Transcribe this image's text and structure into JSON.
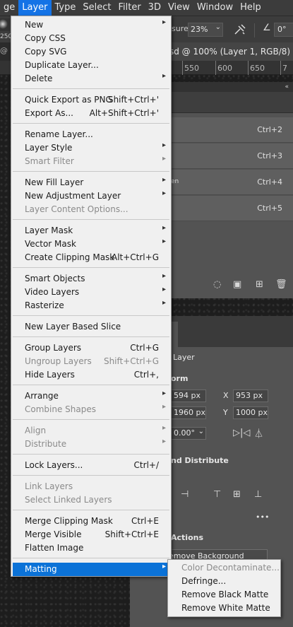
{
  "menubar": {
    "items": [
      "ge",
      "Layer",
      "Type",
      "Select",
      "Filter",
      "3D",
      "View",
      "Window",
      "Help"
    ],
    "active_index": 1
  },
  "options_bar": {
    "brush_size": "250",
    "pressure_label": "sure:",
    "pressure_value": "23%",
    "angle_value": "0°"
  },
  "document": {
    "left_tab_fragment": "@ 3",
    "tab_title": "sd @ 100% (Layer 1, RGB/8) *",
    "close_glyph": "×",
    "ruler_ticks": [
      "550",
      "600",
      "650",
      "7"
    ]
  },
  "layers_panel": {
    "rows": [
      {
        "text": "",
        "shortcut": "Ctrl+2"
      },
      {
        "text": "",
        "shortcut": "Ctrl+3"
      },
      {
        "text": "en",
        "shortcut": "Ctrl+4"
      },
      {
        "text": "",
        "shortcut": "Ctrl+5"
      }
    ]
  },
  "properties_panel": {
    "kind_label": "Layer",
    "transform_label": "orm",
    "w_value": "594 px",
    "x_label": "X",
    "x_value": "953 px",
    "h_value": "1960 px",
    "y_label": "Y",
    "y_value": "1000 px",
    "angle_value": "0.00°",
    "align_label": "nd Distribute",
    "more": "•••",
    "quick_actions_label": "Actions",
    "remove_bg_label": "emove Background"
  },
  "layer_menu": {
    "sections": [
      [
        {
          "label": "New",
          "shortcut": "",
          "submenu": true,
          "disabled": false
        },
        {
          "label": "Copy CSS",
          "shortcut": "",
          "submenu": false,
          "disabled": false
        },
        {
          "label": "Copy SVG",
          "shortcut": "",
          "submenu": false,
          "disabled": false
        },
        {
          "label": "Duplicate Layer...",
          "shortcut": "",
          "submenu": false,
          "disabled": false
        },
        {
          "label": "Delete",
          "shortcut": "",
          "submenu": true,
          "disabled": false
        }
      ],
      [
        {
          "label": "Quick Export as PNG",
          "shortcut": "Shift+Ctrl+'",
          "submenu": false,
          "disabled": false
        },
        {
          "label": "Export As...",
          "shortcut": "Alt+Shift+Ctrl+'",
          "submenu": false,
          "disabled": false
        }
      ],
      [
        {
          "label": "Rename Layer...",
          "shortcut": "",
          "submenu": false,
          "disabled": false
        },
        {
          "label": "Layer Style",
          "shortcut": "",
          "submenu": true,
          "disabled": false
        },
        {
          "label": "Smart Filter",
          "shortcut": "",
          "submenu": true,
          "disabled": true
        }
      ],
      [
        {
          "label": "New Fill Layer",
          "shortcut": "",
          "submenu": true,
          "disabled": false
        },
        {
          "label": "New Adjustment Layer",
          "shortcut": "",
          "submenu": true,
          "disabled": false
        },
        {
          "label": "Layer Content Options...",
          "shortcut": "",
          "submenu": false,
          "disabled": true
        }
      ],
      [
        {
          "label": "Layer Mask",
          "shortcut": "",
          "submenu": true,
          "disabled": false
        },
        {
          "label": "Vector Mask",
          "shortcut": "",
          "submenu": true,
          "disabled": false
        },
        {
          "label": "Create Clipping Mask",
          "shortcut": "Alt+Ctrl+G",
          "submenu": false,
          "disabled": false
        }
      ],
      [
        {
          "label": "Smart Objects",
          "shortcut": "",
          "submenu": true,
          "disabled": false
        },
        {
          "label": "Video Layers",
          "shortcut": "",
          "submenu": true,
          "disabled": false
        },
        {
          "label": "Rasterize",
          "shortcut": "",
          "submenu": true,
          "disabled": false
        }
      ],
      [
        {
          "label": "New Layer Based Slice",
          "shortcut": "",
          "submenu": false,
          "disabled": false
        }
      ],
      [
        {
          "label": "Group Layers",
          "shortcut": "Ctrl+G",
          "submenu": false,
          "disabled": false
        },
        {
          "label": "Ungroup Layers",
          "shortcut": "Shift+Ctrl+G",
          "submenu": false,
          "disabled": true
        },
        {
          "label": "Hide Layers",
          "shortcut": "Ctrl+,",
          "submenu": false,
          "disabled": false
        }
      ],
      [
        {
          "label": "Arrange",
          "shortcut": "",
          "submenu": true,
          "disabled": false
        },
        {
          "label": "Combine Shapes",
          "shortcut": "",
          "submenu": true,
          "disabled": true
        }
      ],
      [
        {
          "label": "Align",
          "shortcut": "",
          "submenu": true,
          "disabled": true
        },
        {
          "label": "Distribute",
          "shortcut": "",
          "submenu": true,
          "disabled": true
        }
      ],
      [
        {
          "label": "Lock Layers...",
          "shortcut": "Ctrl+/",
          "submenu": false,
          "disabled": false
        }
      ],
      [
        {
          "label": "Link Layers",
          "shortcut": "",
          "submenu": false,
          "disabled": true
        },
        {
          "label": "Select Linked Layers",
          "shortcut": "",
          "submenu": false,
          "disabled": true
        }
      ],
      [
        {
          "label": "Merge Clipping Mask",
          "shortcut": "Ctrl+E",
          "submenu": false,
          "disabled": false
        },
        {
          "label": "Merge Visible",
          "shortcut": "Shift+Ctrl+E",
          "submenu": false,
          "disabled": false
        },
        {
          "label": "Flatten Image",
          "shortcut": "",
          "submenu": false,
          "disabled": false
        }
      ],
      [
        {
          "label": "Matting",
          "shortcut": "",
          "submenu": true,
          "disabled": false,
          "highlighted": true
        }
      ]
    ]
  },
  "matting_submenu": {
    "items": [
      {
        "label": "Color Decontaminate...",
        "disabled": true
      },
      {
        "label": "Defringe...",
        "disabled": false
      },
      {
        "label": "Remove Black Matte",
        "disabled": false
      },
      {
        "label": "Remove White Matte",
        "disabled": false
      }
    ]
  },
  "colors": {
    "highlight": "#0b72d7",
    "menubar_active": "#1473e6",
    "menu_bg": "#f0f0f0",
    "disabled_text": "#8a8a8a"
  }
}
